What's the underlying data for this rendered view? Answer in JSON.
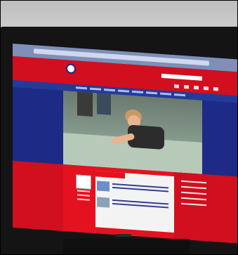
{
  "scene": {
    "screen_accent": "#d10f1f",
    "screen_primary": "#1f2a8a",
    "has_text_legible": false
  }
}
